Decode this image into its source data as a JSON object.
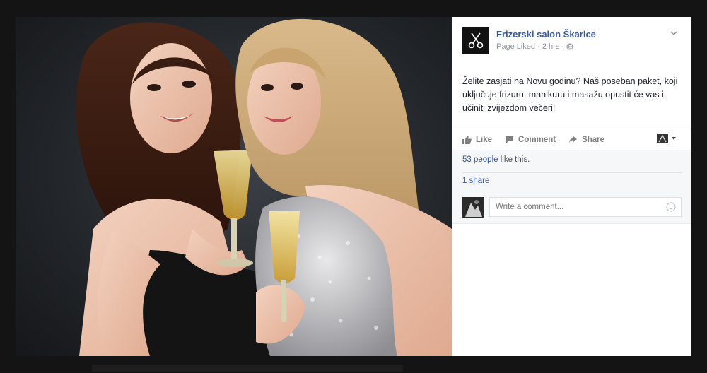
{
  "post": {
    "page_name": "Frizerski salon Škarice",
    "page_liked": "Page Liked",
    "separator": "·",
    "time": "2 hrs",
    "text": "Želite zasjati na Novu godinu? Naš poseban paket, koji uključuje frizuru, manikuru i masažu opustit će vas i učiniti zvijezdom večeri!"
  },
  "actions": {
    "like": "Like",
    "comment": "Comment",
    "share": "Share"
  },
  "feedback": {
    "likes_count": "53 people",
    "likes_suffix": " like this.",
    "shares": "1 share",
    "comment_placeholder": "Write a comment..."
  },
  "colors": {
    "link": "#365899",
    "muted": "#90949c",
    "text": "#1d2129"
  },
  "icons": [
    "scissors-icon",
    "chevron-down-icon",
    "globe-icon",
    "like-icon",
    "comment-icon",
    "share-icon",
    "emoji-icon"
  ]
}
